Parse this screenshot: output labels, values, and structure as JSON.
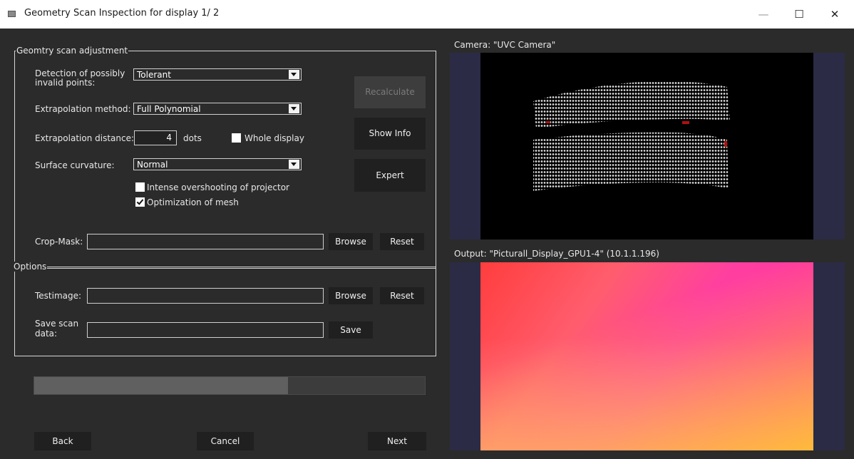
{
  "window": {
    "title": "Geometry Scan Inspection  for display 1/ 2",
    "minimize": "—",
    "maximize": "☐",
    "close": "✕"
  },
  "adjust": {
    "legend": "Geomtry scan adjustment",
    "detection_label_1": "Detection of possibly",
    "detection_label_2": "invalid points:",
    "detection_value": "Tolerant",
    "extrap_method_label": "Extrapolation method:",
    "extrap_method_value": "Full Polynomial",
    "extrap_distance_label": "Extrapolation distance:",
    "extrap_distance_value": "4",
    "extrap_distance_unit": "dots",
    "whole_display_label": "Whole display",
    "whole_display_checked": false,
    "curvature_label": "Surface curvature:",
    "curvature_value": "Normal",
    "overshoot_label": "Intense overshooting of projector",
    "overshoot_checked": false,
    "optimization_label": "Optimization of mesh",
    "optimization_checked": true,
    "recalculate": "Recalculate",
    "show_info": "Show Info",
    "expert": "Expert",
    "cropmask_label": "Crop-Mask:",
    "cropmask_value": "",
    "browse": "Browse",
    "reset": "Reset"
  },
  "options": {
    "legend": "Options",
    "testimage_label": "Testimage:",
    "testimage_value": "",
    "browse": "Browse",
    "reset": "Reset",
    "save_label_1": "Save scan",
    "save_label_2": "data:",
    "save_value": "",
    "save": "Save"
  },
  "progress": {
    "value": 0.65
  },
  "nav": {
    "back": "Back",
    "cancel": "Cancel",
    "next": "Next"
  },
  "camera": {
    "title": "Camera: \"UVC Camera\""
  },
  "output": {
    "title": "Output: \"Picturall_Display_GPU1-4\"  (10.1.1.196)"
  },
  "colors": {
    "panel_side": "#2b2b45",
    "background": "#2b2b2b"
  }
}
